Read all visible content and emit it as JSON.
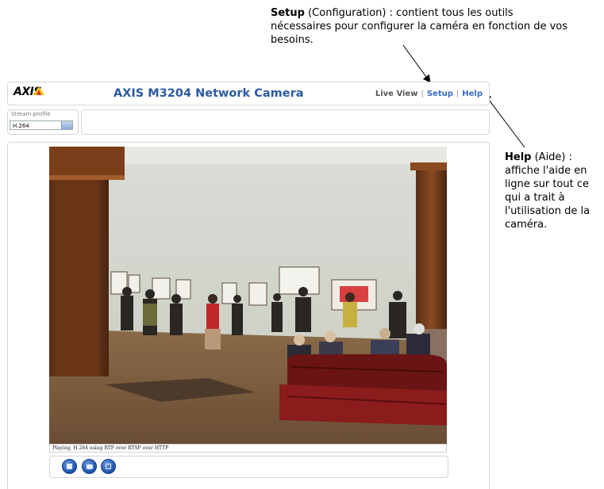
{
  "annotations": {
    "setup": {
      "bold": "Setup",
      "rest": " (Configuration) : contient tous les outils nécessaires pour configurer la caméra en fonction de vos besoins."
    },
    "help": {
      "bold": "Help",
      "rest": " (Aide) : affiche l'aide en ligne sur tout ce qui a trait à l'utilisation de la caméra."
    }
  },
  "header": {
    "logo": "AXIS",
    "title": "AXIS M3204 Network Camera",
    "nav": {
      "live_view": "Live View",
      "setup": "Setup",
      "help": "Help"
    }
  },
  "stream_profile": {
    "label": "Stream profile",
    "selected": "H.264"
  },
  "video": {
    "status_text": "Playing, H.264 using RTP over RTSP over HTTP"
  },
  "toolbar": {
    "buttons": [
      "stop-icon",
      "snapshot-icon",
      "fullscreen-icon"
    ]
  },
  "colors": {
    "title_blue": "#2c5aa0",
    "link_blue": "#3a6cc0",
    "button_blue": "#1d4fa8",
    "axis_yellow": "#f6c400"
  }
}
